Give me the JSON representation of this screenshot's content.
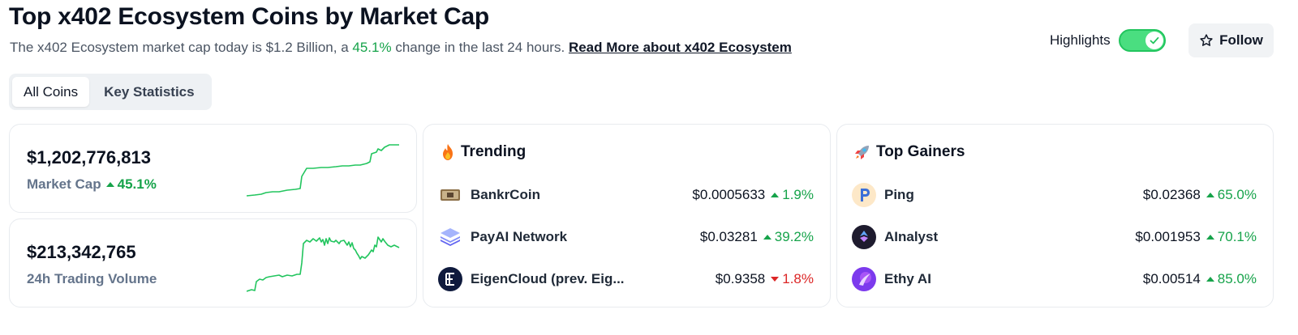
{
  "header": {
    "title": "Top x402 Ecosystem Coins by Market Cap",
    "subtitle_prefix": "The x402 Ecosystem market cap today is $1.2 Billion, a",
    "subtitle_change": "45.1%",
    "subtitle_suffix": "change in the last 24 hours.",
    "read_more": "Read More about x402 Ecosystem",
    "highlights_label": "Highlights",
    "highlights_on": true,
    "follow_label": "Follow"
  },
  "tabs": [
    {
      "label": "All Coins",
      "active": true
    },
    {
      "label": "Key Statistics",
      "active": false
    }
  ],
  "stats": {
    "market_cap": {
      "value": "$1,202,776,813",
      "label": "Market Cap",
      "change": "45.1%",
      "direction": "up"
    },
    "volume": {
      "value": "$213,342,765",
      "label": "24h Trading Volume"
    }
  },
  "trending": {
    "title": "Trending",
    "icon": "fire-icon",
    "rows": [
      {
        "name": "BankrCoin",
        "price": "$0.0005633",
        "change": "1.9%",
        "direction": "up",
        "icon": "bankrcoin-icon"
      },
      {
        "name": "PayAI Network",
        "price": "$0.03281",
        "change": "39.2%",
        "direction": "up",
        "icon": "payai-icon"
      },
      {
        "name": "EigenCloud (prev. Eig...",
        "price": "$0.9358",
        "change": "1.8%",
        "direction": "down",
        "icon": "eigencloud-icon"
      }
    ]
  },
  "gainers": {
    "title": "Top Gainers",
    "icon": "rocket-icon",
    "rows": [
      {
        "name": "Ping",
        "price": "$0.02368",
        "change": "65.0%",
        "direction": "up",
        "icon": "ping-icon"
      },
      {
        "name": "AInalyst",
        "price": "$0.001953",
        "change": "70.1%",
        "direction": "up",
        "icon": "ainalyst-icon"
      },
      {
        "name": "Ethy AI",
        "price": "$0.00514",
        "change": "85.0%",
        "direction": "up",
        "icon": "ethy-ai-icon"
      }
    ]
  },
  "colors": {
    "positive": "#16a34a",
    "negative": "#dc2626",
    "spark": "#22c55e",
    "toggle": "#4ade80"
  }
}
